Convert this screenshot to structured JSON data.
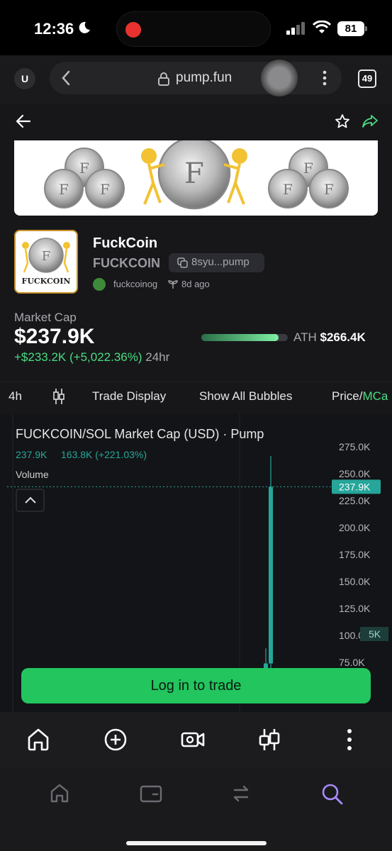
{
  "status": {
    "time": "12:36",
    "battery": "81"
  },
  "browser": {
    "user_initial": "U",
    "url": "pump.fun",
    "tab_count": "49"
  },
  "token": {
    "name": "FuckCoin",
    "ticker": "FUCKCOIN",
    "contract_short": "8syu...pump",
    "creator": "fuckcoinog",
    "created_ago": "8d ago",
    "avatar_caption": "FUCKCOIN",
    "coin_letter": "F"
  },
  "market": {
    "label": "Market Cap",
    "value": "$237.9K",
    "change": "+$233.2K (+5,022.36%)",
    "period": "24hr",
    "ath_label": "ATH",
    "ath_value": "$266.4K",
    "ath_progress": 0.893
  },
  "toolbar": {
    "interval": "4h",
    "trade_display": "Trade Display",
    "show_bubbles": "Show All Bubbles",
    "price_label": "Price/",
    "mcap_label": "MCa"
  },
  "chart_data": {
    "type": "candlestick",
    "title": "FUCKCOIN/SOL Market Cap (USD) · Pump",
    "last": "237.9K",
    "change": "163.8K (+221.03%)",
    "volume_label": "Volume",
    "y_ticks": [
      "275.0K",
      "250.0K",
      "225.0K",
      "200.0K",
      "175.0K",
      "150.0K",
      "125.0K",
      "100.0K",
      "75.0K"
    ],
    "y_tick_values": [
      275000,
      250000,
      225000,
      200000,
      175000,
      150000,
      125000,
      100000,
      75000
    ],
    "ylim": [
      60000,
      285000
    ],
    "last_price_value": 237900,
    "last_price_label": "237.9K",
    "partial_label": "5K",
    "candles": [
      {
        "open": 62000,
        "high": 88000,
        "low": 60000,
        "close": 74000,
        "color": "#26a69a"
      },
      {
        "open": 74000,
        "high": 266400,
        "low": 62000,
        "close": 237900,
        "color": "#26a69a"
      }
    ],
    "colors": {
      "up": "#26a69a",
      "last_price": "#26a69a"
    }
  },
  "cta": {
    "label": "Log in to trade"
  },
  "colors": {
    "accent": "#22c55e",
    "positive": "#4ade80",
    "ath_border": "#c8912a"
  }
}
